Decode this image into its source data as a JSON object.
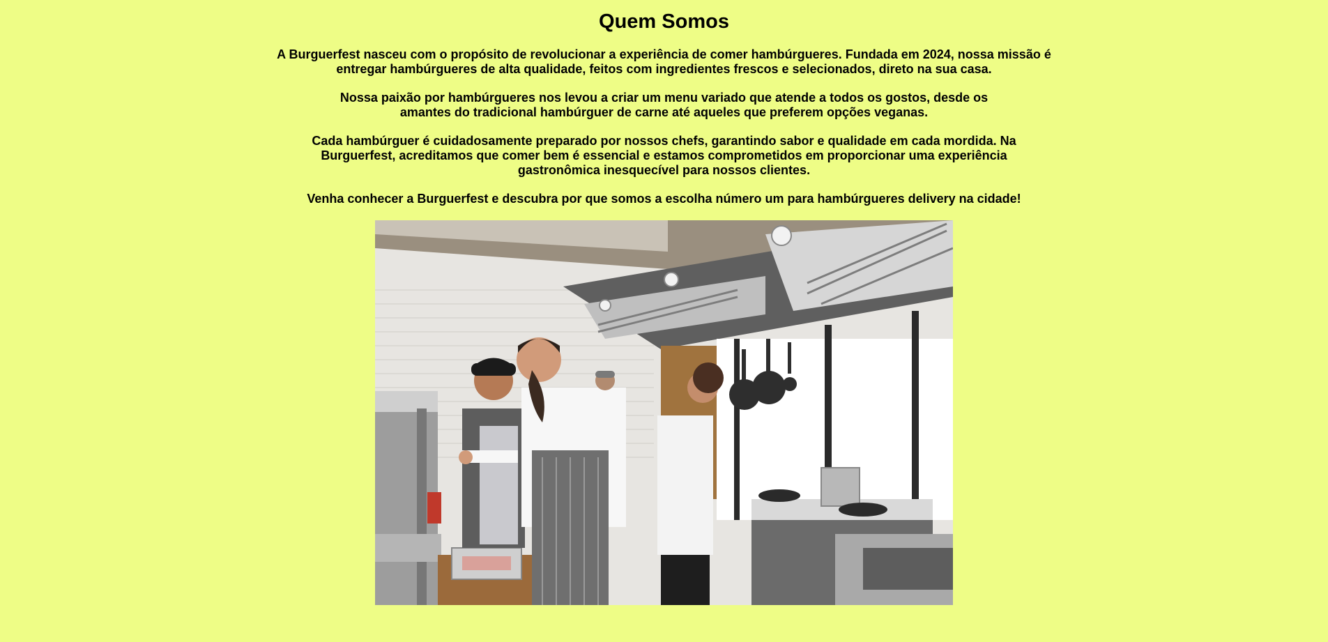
{
  "about": {
    "title": "Quem Somos",
    "paragraphs": [
      "A Burguerfest nasceu com o propósito de revolucionar a experiência de comer hambúrgueres. Fundada em 2024, nossa missão é entregar hambúrgueres de alta qualidade, feitos com ingredientes frescos e selecionados, direto na sua casa.",
      "Nossa paixão por hambúrgueres nos levou a criar um menu variado que atende a todos os gostos, desde os amantes do tradicional hambúrguer de carne até aqueles que preferem opções veganas.",
      "Cada hambúrguer é cuidadosamente preparado por nossos chefs, garantindo sabor e qualidade em cada mordida. Na Burguerfest, acreditamos que comer bem é essencial e estamos comprometidos em proporcionar uma experiência gastronômica inesquecível para nossos clientes.",
      "Venha conhecer a Burguerfest e descubra por que somos a escolha número um para hambúrgueres delivery na cidade!"
    ]
  },
  "colors": {
    "background": "#eefd86",
    "text": "#000000"
  }
}
